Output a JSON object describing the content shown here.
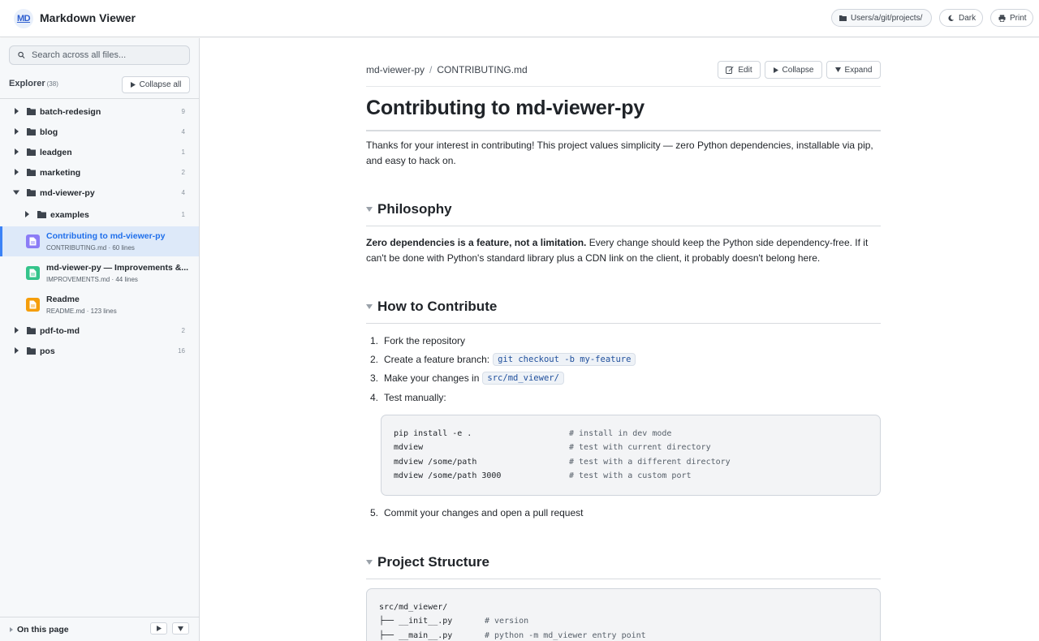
{
  "app": {
    "logo_text": "MD",
    "title": "Markdown Viewer",
    "path_label": "Users/a/git/projects/",
    "dark_label": "Dark",
    "print_label": "Print"
  },
  "sidebar": {
    "search_placeholder": "Search across all files...",
    "explorer_label": "Explorer",
    "explorer_count": "(38)",
    "collapse_all_label": "Collapse all",
    "folders": [
      {
        "name": "batch-redesign",
        "count": "9",
        "expanded": false
      },
      {
        "name": "blog",
        "count": "4",
        "expanded": false
      },
      {
        "name": "leadgen",
        "count": "1",
        "expanded": false
      },
      {
        "name": "marketing",
        "count": "2",
        "expanded": false
      },
      {
        "name": "md-viewer-py",
        "count": "4",
        "expanded": true
      }
    ],
    "subfolder": {
      "name": "examples",
      "count": "1"
    },
    "files": [
      {
        "title": "Contributing to md-viewer-py",
        "meta": "CONTRIBUTING.md · 60 lines",
        "color": "#8b7cf6",
        "active": true
      },
      {
        "title": "md-viewer-py — Improvements &...",
        "meta": "IMPROVEMENTS.md · 44 lines",
        "color": "#34c48b",
        "active": false
      },
      {
        "title": "Readme",
        "meta": "README.md · 123 lines",
        "color": "#f59e0b",
        "active": false
      }
    ],
    "folders_after": [
      {
        "name": "pdf-to-md",
        "count": "2"
      },
      {
        "name": "pos",
        "count": "16"
      }
    ],
    "on_this_page_label": "On this page"
  },
  "doc": {
    "breadcrumb_repo": "md-viewer-py",
    "breadcrumb_sep": "/",
    "breadcrumb_file": "CONTRIBUTING.md",
    "edit_label": "Edit",
    "collapse_label": "Collapse",
    "expand_label": "Expand",
    "title": "Contributing to md-viewer-py",
    "intro_line1": "Thanks for your interest in contributing! This project values simplicity — zero Python dependencies, installable via pip,",
    "intro_line2": "and easy to hack on.",
    "philosophy": {
      "heading": "Philosophy",
      "bold": "Zero dependencies is a feature, not a limitation.",
      "rest_line1": " Every change should keep the Python side dependency-free. If it",
      "line2": "can't be done with Python's standard library plus a CDN link on the client, it probably doesn't belong here."
    },
    "contribute": {
      "heading": "How to Contribute",
      "steps": [
        {
          "num": "1.",
          "text": "Fork the repository",
          "code": ""
        },
        {
          "num": "2.",
          "text": "Create a feature branch:",
          "code": "git checkout -b my-feature"
        },
        {
          "num": "3.",
          "text": "Make your changes in",
          "code": "src/md_viewer/"
        },
        {
          "num": "4.",
          "text": "Test manually:",
          "code": ""
        }
      ],
      "code_lines": [
        {
          "cmd": "pip install -e .",
          "comment": "# install in dev mode"
        },
        {
          "cmd": "mdview",
          "comment": "# test with current directory"
        },
        {
          "cmd": "mdview /some/path",
          "comment": "# test with a different directory"
        },
        {
          "cmd": "mdview /some/path 3000",
          "comment": "# test with a custom port"
        }
      ],
      "step5": {
        "num": "5.",
        "text": "Commit your changes and open a pull request"
      }
    },
    "structure": {
      "heading": "Project Structure",
      "lines": [
        {
          "cmd": "src/md_viewer/",
          "comment": ""
        },
        {
          "cmd": "├── __init__.py",
          "comment": "# version"
        },
        {
          "cmd": "├── __main__.py",
          "comment": "# python -m md_viewer entry point"
        }
      ]
    }
  }
}
